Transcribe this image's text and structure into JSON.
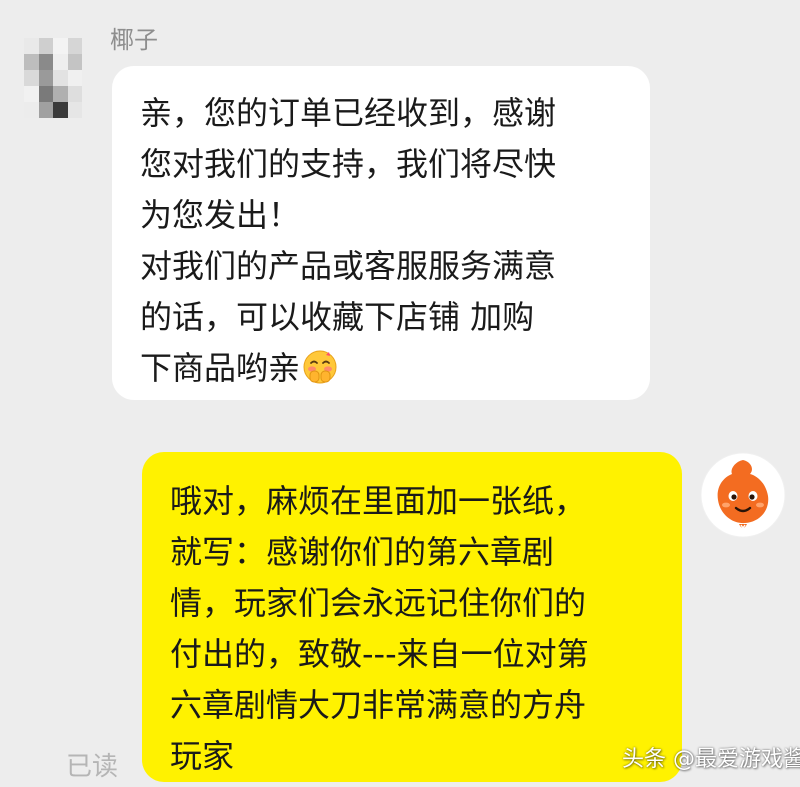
{
  "contact": {
    "name": "椰子"
  },
  "messages": [
    {
      "from": "contact",
      "lines": [
        "亲，您的订单已经收到，感谢",
        "您对我们的支持，我们将尽快",
        "为您发出！",
        "对我们的产品或客服服务满意",
        "的话，可以收藏下店铺 加购",
        "下商品哟亲"
      ],
      "emoji": "blush-face"
    },
    {
      "from": "self",
      "lines": [
        "哦对，麻烦在里面加一张纸，",
        "就写：感谢你们的第六章剧",
        "情，玩家们会永远记住你们的",
        "付出的，致敬---来自一位对第",
        "六章剧情大刀非常满意的方舟",
        "玩家"
      ]
    }
  ],
  "status": {
    "read_label": "已读"
  },
  "watermark": {
    "text": "头条 @最爱游戏酱"
  },
  "colors": {
    "background": "#ededed",
    "contact_bubble": "#ffffff",
    "self_bubble": "#fff200",
    "avatar_orange": "#f36c21"
  }
}
